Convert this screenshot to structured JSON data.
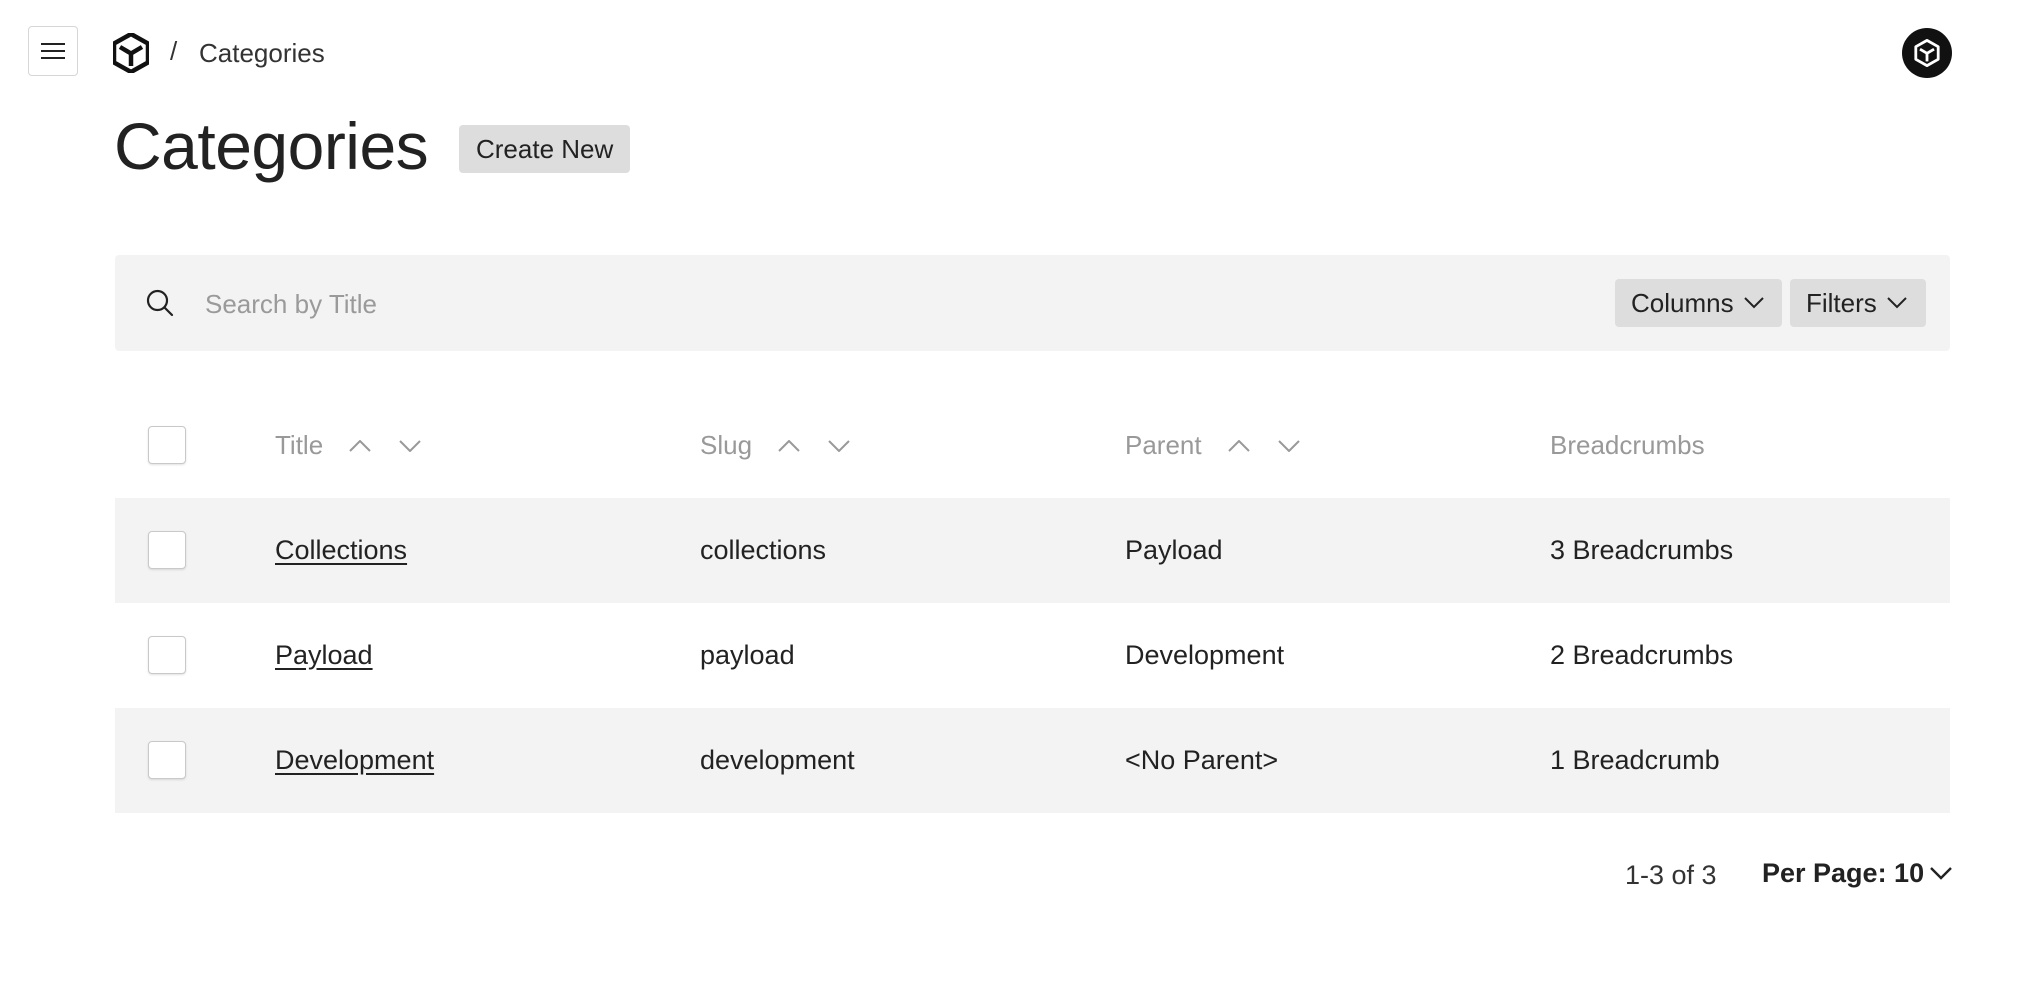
{
  "header": {
    "menu_icon": "hamburger-icon",
    "logo_icon": "payload-logo-icon",
    "breadcrumb_separator": "/",
    "breadcrumb_current": "Categories",
    "account_icon": "account-avatar-icon"
  },
  "page": {
    "title": "Categories",
    "create_button": "Create New"
  },
  "search": {
    "placeholder": "Search by Title",
    "value": "",
    "icon": "search-icon",
    "columns_label": "Columns",
    "filters_label": "Filters"
  },
  "table": {
    "columns": [
      {
        "label": "Title",
        "sortable": true
      },
      {
        "label": "Slug",
        "sortable": true
      },
      {
        "label": "Parent",
        "sortable": true
      },
      {
        "label": "Breadcrumbs",
        "sortable": false
      }
    ],
    "rows": [
      {
        "title": "Collections",
        "slug": "collections",
        "parent": "Payload",
        "breadcrumbs": "3 Breadcrumbs"
      },
      {
        "title": "Payload",
        "slug": "payload",
        "parent": "Development",
        "breadcrumbs": "2 Breadcrumbs"
      },
      {
        "title": "Development",
        "slug": "development",
        "parent": "<No Parent>",
        "breadcrumbs": "1 Breadcrumb"
      }
    ]
  },
  "pagination": {
    "range": "1-3 of 3",
    "per_page": "Per Page: 10"
  },
  "colors": {
    "text": "#222222",
    "muted": "#999999",
    "panel": "#f3f3f3",
    "button": "#dddddd"
  }
}
